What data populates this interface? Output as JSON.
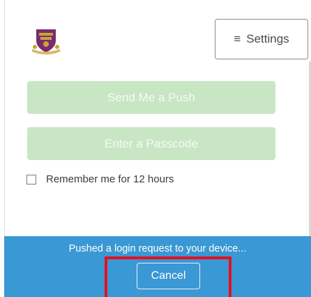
{
  "header": {
    "logo_icon": "university-crest-icon",
    "settings": {
      "icon": "hamburger-menu-icon",
      "label": "Settings"
    }
  },
  "auth": {
    "push_label": "Send Me a Push",
    "passcode_label": "Enter a Passcode",
    "remember_label": "Remember me for 12 hours",
    "remember_checked": false
  },
  "status": {
    "message": "Pushed a login request to your device...",
    "cancel_label": "Cancel"
  },
  "colors": {
    "accent_blue": "#3a98d4",
    "disabled_green": "#c8e6c4",
    "highlight_red": "#e8101f"
  }
}
